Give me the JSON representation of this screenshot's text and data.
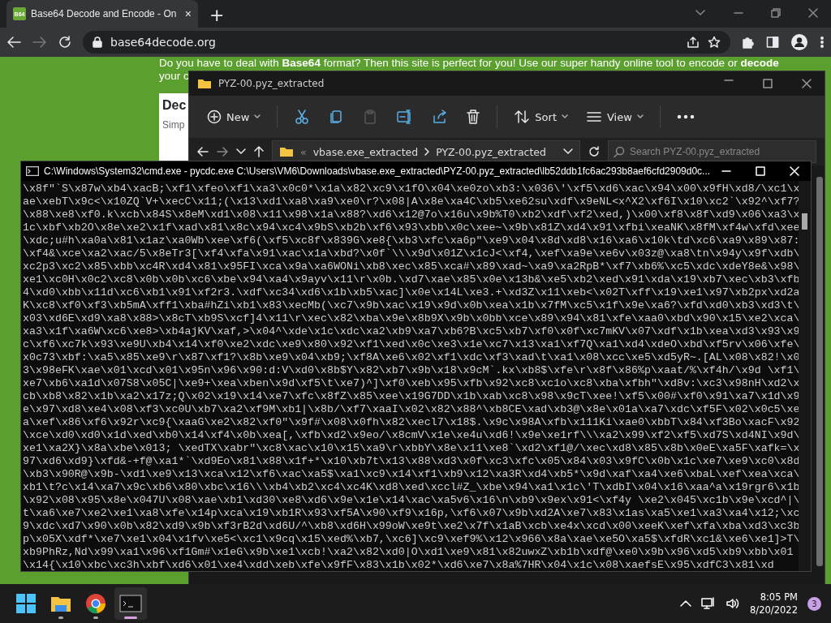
{
  "browser": {
    "tab": {
      "favicon": "B64",
      "title": "Base64 Decode and Encode - On",
      "close": "×",
      "selected": true
    },
    "new_tab": "+",
    "url": "base64decode.org",
    "page": {
      "intro": "Do you have to deal with **Base64** format? Then this site is perfect for you! Use our super handy online tool to encode or **decode**",
      "intro_cont": "your c",
      "card_title": "Dec",
      "card_subtitle": "Simp"
    }
  },
  "explorer": {
    "title": "PYZ-00.pyz_extracted",
    "toolbar": [
      {
        "kind": "new",
        "label": "New"
      },
      {
        "kind": "cut"
      },
      {
        "kind": "copy"
      },
      {
        "kind": "paste",
        "disabled": true
      },
      {
        "kind": "rename"
      },
      {
        "kind": "share"
      },
      {
        "kind": "delete"
      },
      {
        "kind": "sort",
        "label": "Sort"
      },
      {
        "kind": "view",
        "label": "View"
      },
      {
        "kind": "more"
      }
    ],
    "breadcrumb_overflow": "«",
    "path": [
      "vbase.exe_extracted",
      "PYZ-00.pyz_extracted"
    ],
    "search_placeholder": "Search PYZ-00.pyz_extracted"
  },
  "console": {
    "title": "C:\\Windows\\System32\\cmd.exe - pycdc.exe  C:\\Users\\VM6\\Downloads\\vbase.exe_extracted\\PYZ-00.pyz_extracted\\lb52ddb1fc6ac293b8aef6cfd2909d0c...",
    "lines": [
      "\\x8f\"`S\\x87w\\xb4\\xacB;\\xf1\\xfeo\\xf1\\xa3\\x0c0*\\x1a\\x82\\xc9\\x1fO\\x04\\xe0zo\\xb3:\\x036\\'\\xf5\\xd6\\xac\\x94\\x00\\x9fH\\xd8/\\xc1\\x",
      "ae\\xebT\\x9c<\\x10ZQ`V+\\xecC\\x11;(\\x13\\xd1\\xa8\\xa9\\xe0\\r?\\x08|A\\x8e\\xa4C\\xb5\\xe62su\\xdf\\x9eNL<x^X2\\xf6I\\x10\\xc2`\\x92^\\xf7?",
      "\\x88\\xe8\\xf0.k\\xcb\\x84S\\x8eM\\xd1\\x08\\x11\\x98\\x1a\\x88?\\xd6\\x12@7o\\x16u\\x9b%T0\\xb2\\xdf\\xf2\\xed,)\\x00\\xf8\\x8f\\xd9\\x06\\xa3\\x",
      "1c\\xbf\\xb2O\\x8e\\xe2\\x1f\\xad\\x81\\x8c\\x94\\xc4\\x9bS\\xb2b\\xf6\\x93\\xbb\\x0c\\xee~\\x9b\\x81Z\\xd4\\x91\\xfbi\\xeaNK\\x8fM\\xf4w\\xfd\\xee",
      "\\xdc;u#h\\xa0a\\x81\\x1az\\xa0Wb\\xee\\xf6(\\xf5\\xc8f\\x839G\\xe8{\\xb3\\xfc\\xa6p\"\\xe9\\x04\\x8d\\xd8\\x16\\xa6\\x10k\\td\\xc6\\xa9\\x89\\x87:",
      "\\xf4&\\xce\\xa2\\xac/5\\x8eTr3[\\xf4\\xfa\\x91\\xac\\x1a\\xbd?\\x0f`\\\\\\x9d\\x01Z\\x1cJ<\\xf4,\\xef\\xa9e\\xe6v\\x03z@\\xa8\\tn\\x94y\\x9f\\xdb\\",
      "xc2p3\\xc2\\x85\\xbb\\xc4R\\xd4\\x81\\x95FI\\xca\\x9a\\xa6WONi\\xb8\\xec\\x85\\xca#\\x89\\xad~\\xa9\\xa2RpB*\\xf7\\xb6%\\xc5\\xdc\\xdeY8e&\\x98\\",
      "xe1\\xc0H\\x0c2\\xc8\\x0b\\x0b\\xc6\\xbe\\x94\\xa4\\x9ayv\\x11\\r\\x0b.\\xd7\\xae\\x85\\x0e\\x13b&\\xe5\\xb2\\xed\\x91\\xda\\x19\\xb7\\xec\\xb3\\xfb",
      "4\\xd0\\xbb\\x11d\\xc6\\xb1\\x91\\xf2r3.\\xdf\\xc34\\xd6\\x1b\\xb5\\xac]\\x0e\\x14L\\xe3.+\\xd3Z\\x11\\xeb<\\x02T\\xff\\x19\\xe1\\x97\\xb2px\\xd2a",
      "K\\xc8\\xf0\\xf3\\xb5mA\\xff1\\xba#hZi\\xb1\\x83\\xecMb(\\xc7\\x9b\\xac\\x19\\x9d\\x0b\\xea\\x1b\\x7fM\\xc5\\x1f\\x9e\\xa6?\\xfd\\xd0\\xb3\\xd3\\t\\",
      "x03\\xd6E\\xd9\\xa8\\x88>\\x8cT\\xb9S\\xcf]4\\x11\\r\\xec\\x82\\xba\\x9e\\x8b9X\\x9b\\x0bb\\xce\\x89\\x94\\x81\\xfe\\xaa0\\xbd\\x90\\x15\\xe2\\xca\\",
      "xa3\\x1f\\xa6W\\xc6\\xe8>\\xb4ajKV\\xaf,>\\x04^\\xde\\x1c\\xdc\\xa2\\xb9\\xa7\\xb6?B\\xc5\\xb7\\xf0\\x0f\\xc7mKV\\x07\\xdf\\x1b\\xea\\xd3\\x93\\x9",
      "c\\xf6\\xc7k\\x93\\xe9U\\xb4\\x14\\xf0\\xe2\\xdc\\xe9\\x80\\x92\\xf1\\xed\\x0c\\xe3\\x1e\\xc7\\x13\\xa1\\xf7Q\\xa1\\xd4\\xdeO\\xbd\\xf5rv\\x06\\xfe\\",
      "x0c73\\xbf:\\xa5\\x85\\xe9\\r\\x87\\xf1?\\x8b\\xe9\\x04\\xb9;\\xf8A\\xe6\\x02\\xf1\\xdc\\xf3\\xad\\t\\xa1\\x08\\xcc\\xe5\\xd5yR~.[AL\\x08\\x82!\\x0",
      "3\\x98eFK\\xae\\x01\\xcd\\x01\\x95n\\x96\\x90:d:V\\xd0\\x8b$Y\\x82\\xb7\\x9b\\x18\\x9cM`.kx\\xb8$\\xfe\\r\\x8f\\x86%p\\xaat/%\\xf4h/\\x9d \\xf1\\",
      "xe7\\xb6\\xa1d\\x07S8\\x05C|\\xe9+\\xea\\xben\\x9d\\xf5\\t\\xe7)^]\\xf0\\xeb\\x95\\xfb\\x92\\xc8\\xc1o\\xc8\\xba\\xfbh\"\\xd8v:\\xc3\\x98nH\\xd2\\x",
      "cb\\xb8\\x82\\x1b\\xa2\\x17z;Q\\x02\\x19\\x14\\xe7\\xfc\\x8fZ\\x85\\xee\\x19G7DD\\x1b\\xab\\xc8\\x98\\x9cT\\xee!\\xf5\\x00#\\xf0\\x91\\xa7\\x1d\\x9",
      "e\\x97\\xd8\\xe4\\x08\\xf3\\xc0U\\xb7\\xa2\\xf9M\\xb1|\\x8b/\\xf7\\xaaI\\x02\\x82\\x88^\\xb8CE\\xad\\xb3@\\x8e\\x01a\\xa7\\xdc\\xf5F\\x02\\x0c5\\xe",
      "a\\xef\\x86\\xf6\\x92r\\xc9{\\xaaG\\xe2\\x82\\xf0\"\\x9f#\\x08\\x0fh\\x82\\xecl7\\x18$.\\x9c\\x98A\\xfb\\x111Ki\\xae0\\xbbT\\x84\\xf3Bo\\xacF\\x92",
      "\\xce\\xd0\\xd0\\x1d\\xed\\xb0\\x14\\xf4\\x0b\\xea[,\\xfb\\xd2\\x9eo/\\x8cmV\\x1e\\xe4u\\xd6!\\x9e\\xe1rf\\\\\\xa2\\x99\\xf2\\xf5\\xd7S\\xd4NI\\x9d\\",
      "xe1\\xa2X}\\x8a\\xbe\\x013; \\xedTX\\xabr\"\\xc8\\xac\\x10\\x15\\xa9\\r\\xbbY\\x8e\\x11\\xe8`\\xd2\\xf1@/\\xec\\xd8\\x85\\x8b\\x0eE\\xa5F\\xafk=\\x",
      "97\\xd6\\xd9}\\xfd&-+f@\\xa1*`\\xd9Eo\\x81\\x88\\x1f+*\\x10\\xb7t\\x13\\x88\\xd3\\x0f\\xc3\\xfc\\x05\\x84\\x03\\x9fC\\x0b\\x1c\\xe7\\xe9\\xc0\\x8d",
      "\\xb3\\x90R@\\x9b-\\xd1\\xe9\\x13\\xca\\x12\\xf6\\xac\\xa5$\\xa1\\xc9\\x14\\xf1\\xb9\\x12\\xa3R\\xd4\\xb5*\\x9d\\xaf\\xa4\\xe6\\xbaL\\xef\\xea\\xca\\",
      "xb1\\t?c\\x14\\xa7\\x9c\\xb6\\x80\\xbc\\x16\\\\\\xb4\\xb2\\xc4\\xc4K\\xd8\\xed\\xccl#Z_\\xbe\\x94\\xa1\\x1c\\'T\\xdbI\\x04\\x16\\xaa^a\\x19rgr6\\x1b",
      "\\x92\\x08\\x95\\x8e\\x047U\\x08\\xae\\xb1\\xd30\\xe8\\xd6\\x9e\\x1e\\x14\\xac\\xa5v6\\x16\\n\\xb9\\x9ex\\x91<\\xf4y \\xe2\\x045\\xc1b\\x9e\\xcd^|\\",
      "t\\xa6\\xe7\\xe2\\xe1\\xa8\\xfe\\x14p\\xca\\x19\\xb1R\\x93\\xf5A\\x90\\xf9\\x16p,\\xf6\\x07\\x9b\\xd2A\\xe7\\x83\\x1as\\xa5\\xe1\\xa3\\xa4\\x12;\\xc",
      "9\\xdc\\xd7\\x90\\x0b\\x82\\xd9\\x9b\\xf3rB2d\\xd6U/^\\xb8\\xd6H\\x99oW\\xe9t\\xe2\\x7f\\x1aB\\xcb\\xe4x\\xcd\\x00\\xeeK\\xef\\xfa\\xba\\xd3\\xc3b",
      "p\\x05X\\xdf*\\xe7\\xe1\\x04\\x1fv\\xe5<\\xc1\\x9cq\\x15\\xed%\\xb7,\\xc6]\\xc9\\xef9%\\x12\\x966\\x8a\\xae\\xe5O\\xa5$\\xfdR\\xc1&\\xe6\\xe1]>T\\",
      "xb9PhRz,Nd\\x99\\xa1\\x96\\xf1Gm#\\x1eG\\x9b\\xe1\\xcb!\\xa2\\x82\\xd0|O\\xd1\\xe9\\x81\\x82uwxZ\\xb1b\\xdf@\\xe0\\x9b\\x96\\xd5\\xb9\\xbb\\x01",
      "\\x14{\\x10\\xbc\\xc3h\\xbf\\xd6\\x01\\xe4\\xdd\\xeb\\xfe\\x9fF\\x83\\x1b\\x02*\\xd6\\xe7\\x8a%7HR\\x04\\x1c\\x08\\xaefsE\\x95\\xdfC3\\x81\\xd"
    ]
  },
  "taskbar": {
    "apps": [
      {
        "kind": "start",
        "selected": false
      },
      {
        "kind": "files",
        "selected": false
      },
      {
        "kind": "browser",
        "selected": false
      },
      {
        "kind": "terminal",
        "selected": true
      }
    ],
    "time": "8:05 PM",
    "date": "8/20/2022",
    "notifications": "3"
  }
}
